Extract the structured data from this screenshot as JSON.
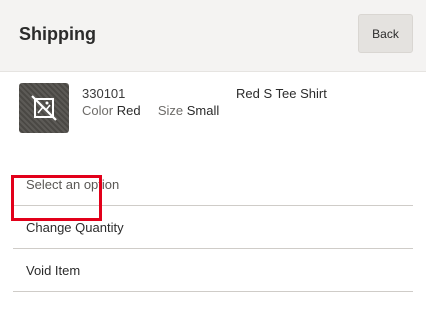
{
  "header": {
    "title": "Shipping",
    "back_label": "Back"
  },
  "item": {
    "sku": "330101",
    "name": "Red S Tee Shirt",
    "color_label": "Color",
    "color_value": "Red",
    "size_label": "Size",
    "size_value": "Small",
    "thumbnail_icon": "image-unavailable-icon"
  },
  "options": {
    "section_label": "Select an option",
    "items": [
      {
        "label": "Change Quantity"
      },
      {
        "label": "Void Item"
      }
    ]
  },
  "colors": {
    "highlight": "#e2001a",
    "header_bg": "#f4f3f2"
  }
}
